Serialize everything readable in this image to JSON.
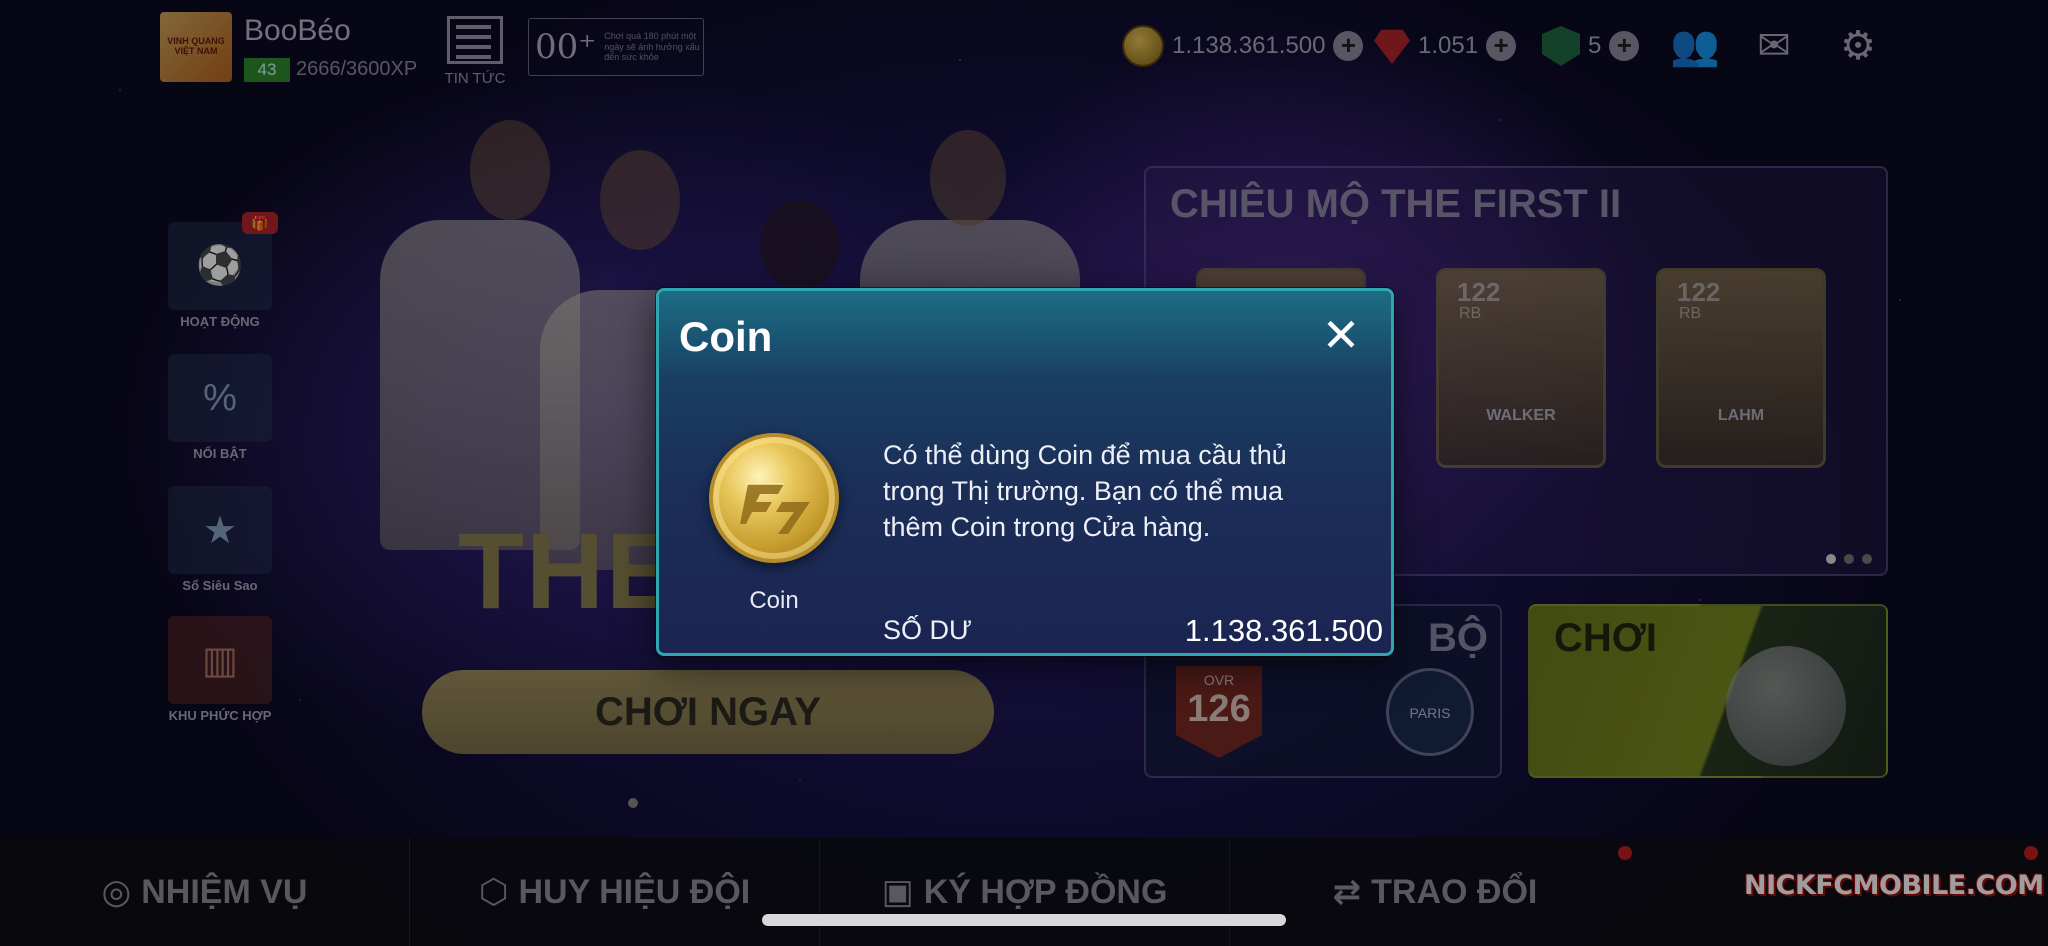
{
  "profile": {
    "name": "BooBéo",
    "level": "43",
    "xp": "2666/3600XP",
    "logo_text": "VINH QUANG VIỆT NAM"
  },
  "header": {
    "news_label": "TIN TỨC",
    "age_rating": "00⁺",
    "age_note": "Chơi quá 180 phút một ngày sẽ ảnh hưởng xấu đến sức khỏe"
  },
  "currencies": {
    "coin": "1.138.361.500",
    "gems": "1.051",
    "tickets": "5"
  },
  "sidebar": {
    "items": [
      {
        "label": "HOẠT ĐỘNG"
      },
      {
        "label": "NỔI BẬT"
      },
      {
        "label": "Sổ Siêu Sao"
      },
      {
        "label": "KHU PHỨC HỢP"
      }
    ]
  },
  "hero": {
    "title": "THE",
    "play_now": "CHƠI NGAY"
  },
  "recruit": {
    "title": "CHIÊU MỘ THE FIRST II",
    "cards": [
      {
        "rating": "122",
        "position": "RB",
        "name": "WALKER"
      },
      {
        "rating": "122",
        "position": "RB",
        "name": "LAHM"
      }
    ]
  },
  "club": {
    "title": "BỘ",
    "ovr_label": "OVR",
    "ovr_value": "126",
    "crest": "PARIS"
  },
  "play_panel": {
    "title": "CHƠI"
  },
  "bottom_nav": {
    "mission": "NHIỆM VỤ",
    "badge": "HUY HIỆU ĐỘI",
    "contract": "KÝ HỢP ĐỒNG",
    "trade": "TRAO ĐỔI"
  },
  "watermark": "NICKFCMOBILE.COM",
  "modal": {
    "title": "Coin",
    "close_symbol": "✕",
    "coin_label": "Coin",
    "description": "Có thể dùng Coin để mua cầu thủ trong Thị trường. Bạn có thể mua thêm Coin trong Cửa hàng.",
    "balance_label": "SỐ DƯ",
    "balance_value": "1.138.361.500"
  },
  "colors": {
    "modal_border": "#2fa7b3",
    "modal_bg": "#1b2e58",
    "coin_gold": "#c49a2c"
  }
}
